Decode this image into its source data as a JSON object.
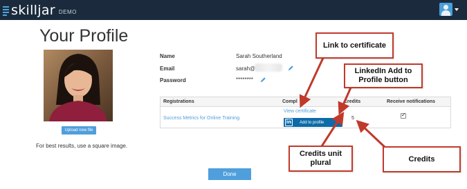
{
  "app": {
    "brand": "skilljar",
    "brand_suffix": "DEMO",
    "user_icon": "user-avatar-icon",
    "menu_icon": "caret-down-icon",
    "colors": {
      "topbar": "#1b2b3d",
      "accent": "#4f9fdc",
      "linkedin": "#0d6ba8",
      "callout_border": "#c0392b"
    }
  },
  "profile": {
    "title": "Your Profile",
    "upload_label": "Upload new file",
    "photo_hint": "For best results, use a square image.",
    "fields": {
      "name_label": "Name",
      "name_value": "Sarah Southerland",
      "email_label": "Email",
      "email_value": "sarah@",
      "password_label": "Password",
      "password_value": "********"
    },
    "edit_icon": "pencil-icon"
  },
  "registrations": {
    "headers": {
      "registrations": "Registrations",
      "completion": "Compl",
      "credits": "Credits",
      "notifications": "Receive notifications"
    },
    "rows": [
      {
        "course": "Success Metrics for Online Training",
        "certificate_link": "View certificate",
        "linkedin_label": "Add to profile",
        "linkedin_icon": "linkedin-icon",
        "credits": "5",
        "notifications_checked": true
      }
    ]
  },
  "done_label": "Done",
  "callouts": {
    "certificate": "Link to certificate",
    "linkedin": "LinkedIn Add to Profile button",
    "credits_unit": "Credits unit plural",
    "credits": "Credits"
  }
}
